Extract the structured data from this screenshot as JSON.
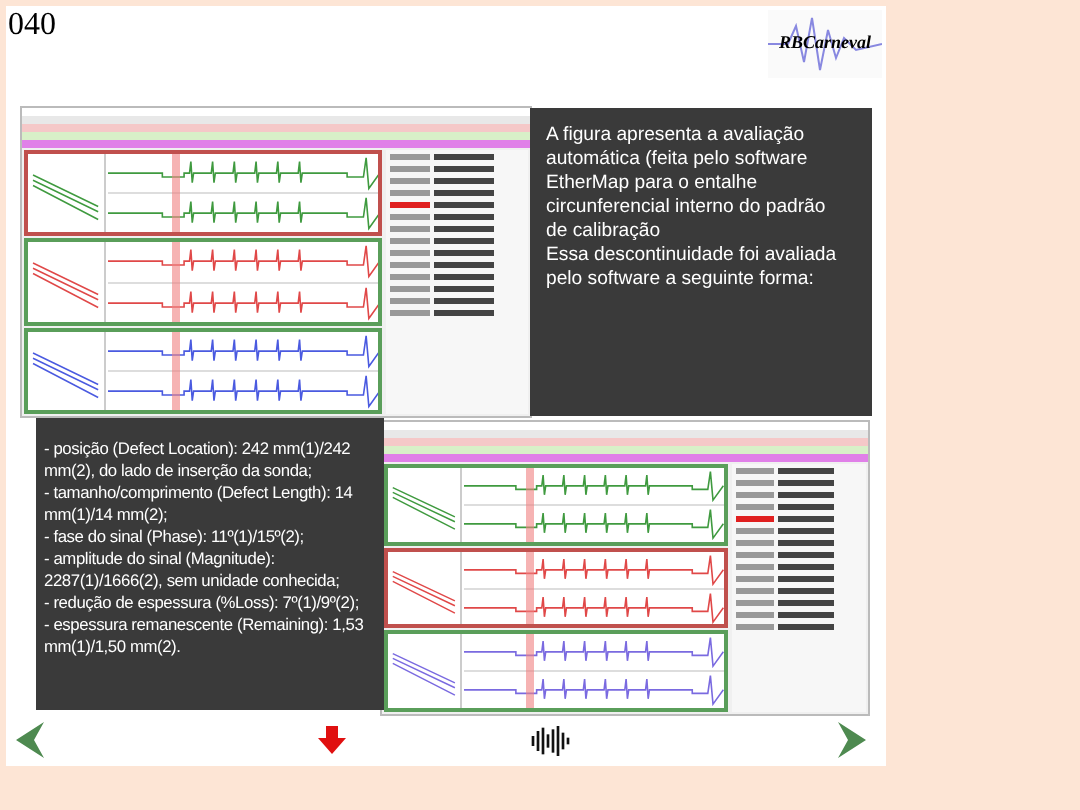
{
  "page_number": "040",
  "logo": {
    "text": "RBCarneval"
  },
  "description_top": [
    "A figura apresenta a avaliação automática (feita pelo software EtherMap para o entalhe circunferencial interno do padrão de calibração",
    "Essa descontinuidade foi avaliada pelo software a seguinte forma:"
  ],
  "description_bottom": [
    "- posição (Defect Location): 242 mm(1)/242 mm(2), do lado de inserção da sonda;",
    "- tamanho/comprimento (Defect Length): 14 mm(1)/14 mm(2);",
    "- fase do sinal (Phase): 11º(1)/15º(2);",
    "- amplitude do sinal (Magnitude): 2287(1)/1666(2), sem unidade conhecida;",
    "- redução de espessura (%Loss): 7º(1)/9º(2);",
    "- espessura remanescente (Remaining): 1,53 mm(1)/1,50 mm(2)."
  ],
  "screenshots": [
    {
      "panels": [
        {
          "selected": true,
          "color": "#3f9a3f"
        },
        {
          "selected": false,
          "color": "#e04848"
        },
        {
          "selected": false,
          "color": "#4a5ae0"
        }
      ]
    },
    {
      "panels": [
        {
          "selected": false,
          "color": "#3f9a3f"
        },
        {
          "selected": true,
          "color": "#e04848"
        },
        {
          "selected": false,
          "color": "#7a6ae0"
        }
      ]
    }
  ]
}
